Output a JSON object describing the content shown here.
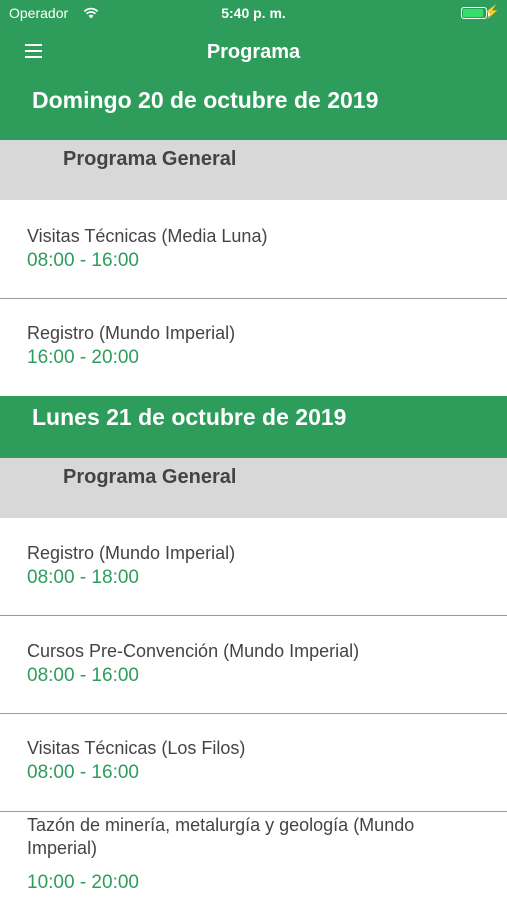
{
  "status_bar": {
    "carrier": "Operador",
    "time": "5:40 p. m.",
    "wifi_icon": "wifi-icon",
    "battery_level": 0.9
  },
  "nav": {
    "title": "Programa",
    "menu_icon": "hamburger-menu-icon"
  },
  "days": [
    {
      "title": "Domingo 20 de octubre de 2019",
      "section": "Programa General",
      "items": [
        {
          "name": "Visitas Técnicas (Media Luna)",
          "time": "08:00 - 16:00"
        },
        {
          "name": "Registro (Mundo Imperial)",
          "time": "16:00 - 20:00"
        }
      ]
    },
    {
      "title": "Lunes 21 de octubre de 2019",
      "section": "Programa General",
      "items": [
        {
          "name": "Registro (Mundo Imperial)",
          "time": "08:00 - 18:00"
        },
        {
          "name": "Cursos Pre-Convención (Mundo Imperial)",
          "time": "08:00 - 16:00"
        },
        {
          "name": "Visitas Técnicas (Los Filos)",
          "time": "08:00 - 16:00"
        },
        {
          "name": "Tazón de minería, metalurgía y geología (Mundo Imperial)",
          "time": "10:00 - 20:00"
        }
      ]
    }
  ],
  "colors": {
    "accent": "#2e9d5c",
    "section_bg": "#d8d8d8",
    "text": "#444444"
  }
}
